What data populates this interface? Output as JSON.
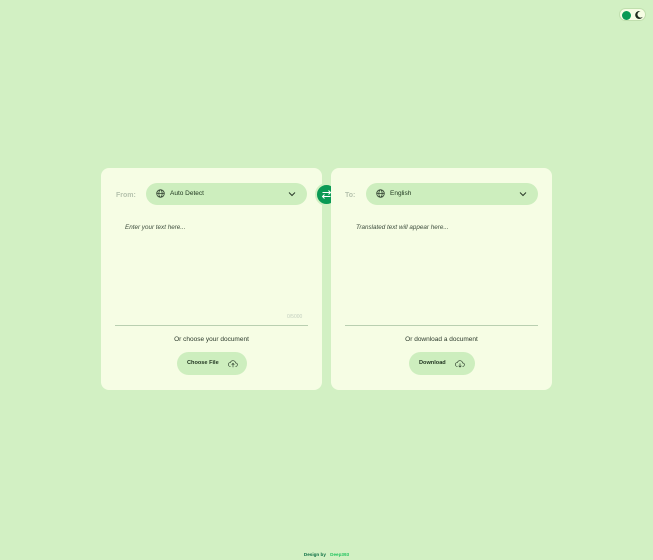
{
  "theme_toggle": {
    "sun_icon": "sun-dot-icon",
    "moon_icon": "moon-icon"
  },
  "source": {
    "label": "From:",
    "language": "Auto Detect",
    "placeholder": "Enter your text here...",
    "counter": "0/5000",
    "doc_caption": "Or choose your document",
    "button_label": "Choose File",
    "icons": {
      "language": "globe-icon",
      "dropdown": "chevron-down-icon",
      "upload": "cloud-upload-icon"
    }
  },
  "target": {
    "label": "To:",
    "language": "English",
    "placeholder": "Translated text will appear here...",
    "doc_caption": "Or download a document",
    "button_label": "Download",
    "icons": {
      "language": "globe-icon",
      "dropdown": "chevron-down-icon",
      "download": "cloud-download-icon"
    }
  },
  "swap": {
    "icon": "swap-arrows-icon"
  },
  "footer": {
    "prefix": "Design by",
    "author": "Deep393"
  },
  "colors": {
    "background": "#d2f0c3",
    "card": "#f6fde4",
    "accent": "#0a9a55",
    "pill": "#cdeebe"
  }
}
